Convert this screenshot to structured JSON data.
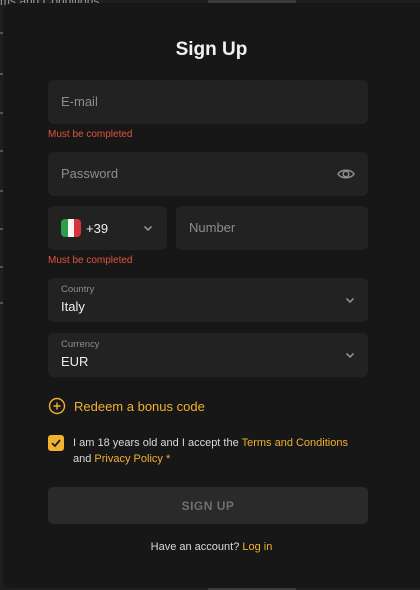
{
  "background": {
    "top_text": "ms and Conditions"
  },
  "title": "Sign Up",
  "email": {
    "placeholder": "E-mail",
    "error": "Must be completed"
  },
  "password": {
    "placeholder": "Password",
    "icon": "eye-icon"
  },
  "phone": {
    "country_flag": "italy-flag",
    "dial_code": "+39",
    "number_placeholder": "Number",
    "error": "Must be completed"
  },
  "country": {
    "label": "Country",
    "value": "Italy"
  },
  "currency": {
    "label": "Currency",
    "value": "EUR"
  },
  "bonus": {
    "label": "Redeem a bonus code",
    "icon": "plus-circle-icon"
  },
  "consent": {
    "checked": true,
    "text_before": "I am 18 years old and I accept the ",
    "terms_link": "Terms and Conditions",
    "text_mid": " and ",
    "privacy_link": "Privacy Policy",
    "required_mark": " *"
  },
  "submit": {
    "label": "SIGN UP"
  },
  "login": {
    "prompt": "Have an account? ",
    "link": "Log in"
  },
  "colors": {
    "accent": "#f2b130",
    "error": "#e0533d",
    "modal_bg": "#171717",
    "field_bg": "#222222"
  }
}
